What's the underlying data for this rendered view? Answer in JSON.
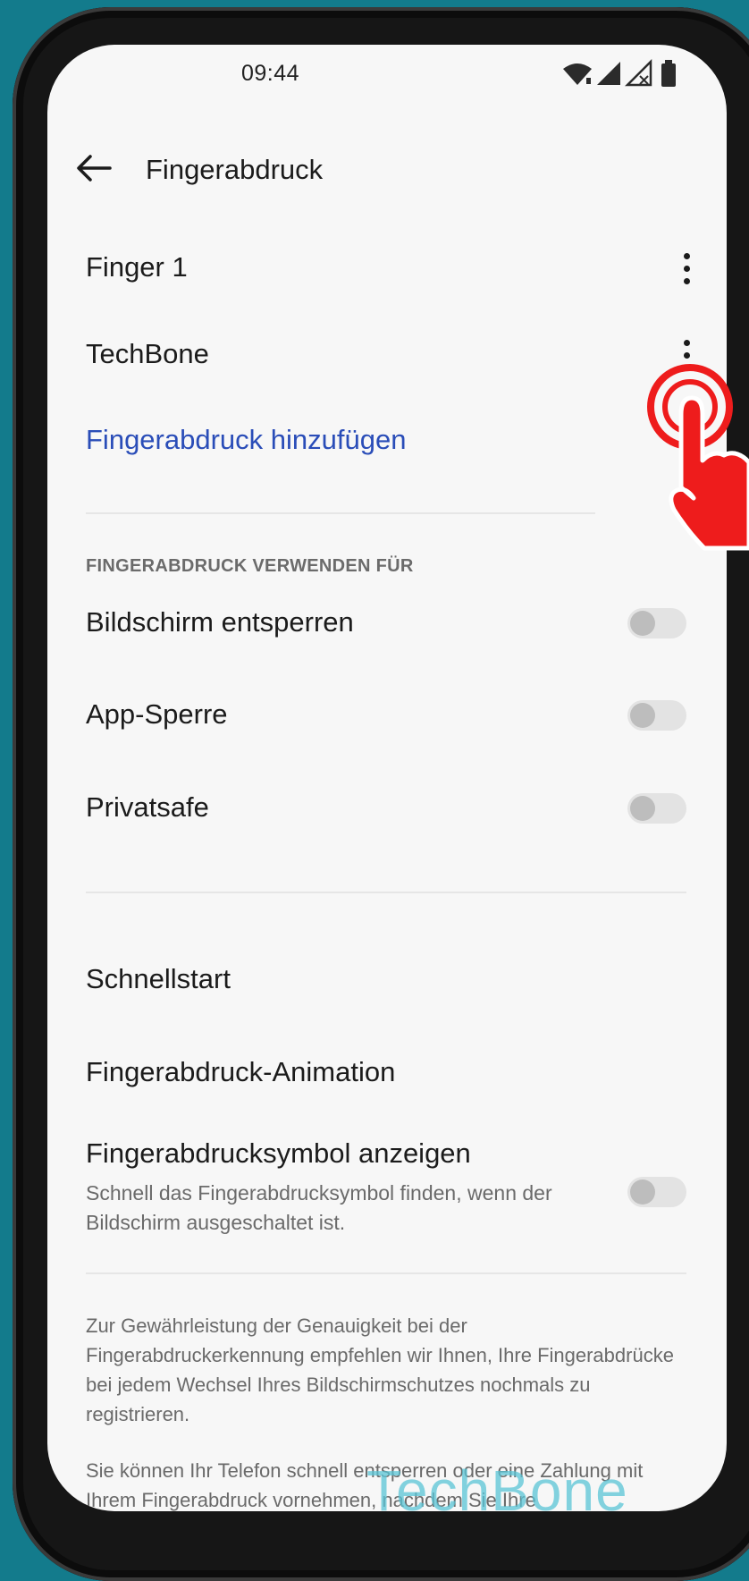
{
  "status_bar": {
    "time": "09:44",
    "icons": [
      "wifi-icon",
      "signal-icon",
      "signal-no-sim-icon",
      "battery-icon"
    ]
  },
  "header": {
    "title": "Fingerabdruck",
    "back_icon": "arrow-left-icon"
  },
  "fingers": [
    {
      "label": "Finger 1",
      "menu_icon": "more-vertical-icon"
    },
    {
      "label": "TechBone",
      "menu_icon": "more-vertical-icon"
    }
  ],
  "add_fingerprint_label": "Fingerabdruck hinzufügen",
  "use_section": {
    "header": "FINGERABDRUCK VERWENDEN FÜR",
    "items": [
      {
        "label": "Bildschirm entsperren",
        "enabled": false
      },
      {
        "label": "App-Sperre",
        "enabled": false
      },
      {
        "label": "Privatsafe",
        "enabled": false
      }
    ]
  },
  "more_settings": {
    "quick_start": "Schnellstart",
    "animation": "Fingerabdruck-Animation",
    "show_icon": {
      "title": "Fingerabdrucksymbol anzeigen",
      "subtitle": "Schnell das Fingerabdrucksymbol finden, wenn der Bildschirm ausgeschaltet ist.",
      "enabled": false
    }
  },
  "notes": {
    "accuracy": "Zur Gewährleistung der Genauigkeit bei der Fingerabdruckerkennung empfehlen wir Ihnen, Ihre Fingerabdrücke bei jedem Wechsel Ihres Bildschirmschutzes nochmals zu registrieren.",
    "usage": "Sie können Ihr Telefon schnell entsperren oder eine Zahlung mit Ihrem Fingerabdruck vornehmen, nachdem Sie Ihre"
  },
  "overlay": {
    "tap_indicator_icon": "tap-hand-icon",
    "tap_color": "#ee1c1c",
    "watermark": "TechBone"
  },
  "colors": {
    "background": "#137b8c",
    "link": "#2a4db8",
    "screen": "#f7f7f7"
  }
}
